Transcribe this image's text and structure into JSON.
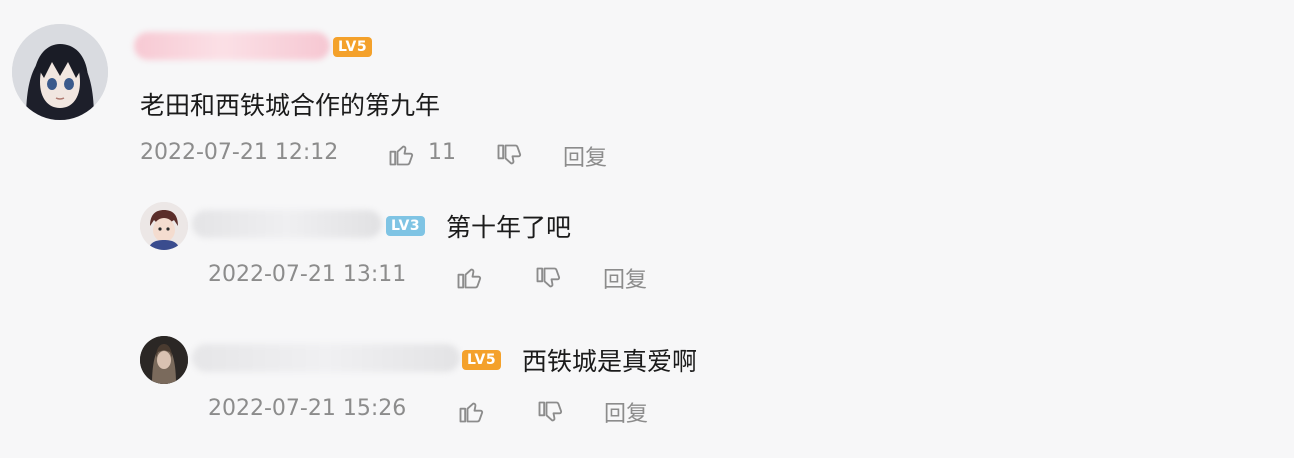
{
  "comments": [
    {
      "level_badge": "LV5",
      "level_color": "#f4a12b",
      "text": "老田和西铁城合作的第九年",
      "time": "2022-07-21 12:12",
      "likes": "11",
      "reply_label": "回复"
    }
  ],
  "replies": [
    {
      "level_badge": "LV3",
      "level_color": "#7fc4e4",
      "text": "第十年了吧",
      "time": "2022-07-21 13:11",
      "reply_label": "回复"
    },
    {
      "level_badge": "LV5",
      "level_color": "#f4a12b",
      "text": "西铁城是真爱啊",
      "time": "2022-07-21 15:26",
      "reply_label": "回复"
    }
  ],
  "icons": {
    "like": "thumbs-up-icon",
    "dislike": "thumbs-down-icon"
  }
}
